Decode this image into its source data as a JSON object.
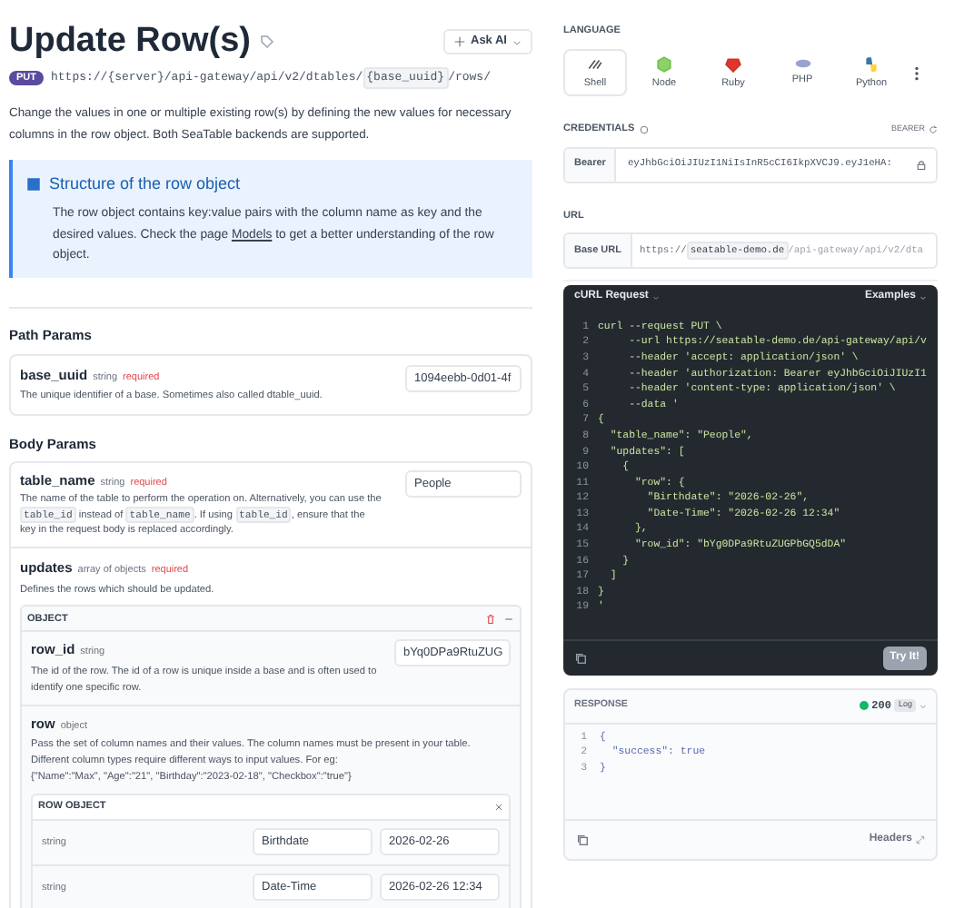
{
  "title": "Update Row(s)",
  "ask_ai": "Ask AI",
  "method": "PUT",
  "endpoint": {
    "prefix": "https://{server}/api-gateway/api/v2/dtables/",
    "param": "{base_uuid}",
    "suffix": "/rows/"
  },
  "description": "Change the values in one or multiple existing row(s) by defining the new values for necessary columns in the row object. Both SeaTable backends are supported.",
  "callout": {
    "title": "Structure of the row object",
    "text_before": "The row object contains key:value pairs with the column name as key and the desired values. Check the page ",
    "link": "Models",
    "text_after": " to get a better understanding of the row object."
  },
  "path_params": {
    "heading": "Path Params",
    "params": [
      {
        "name": "base_uuid",
        "type": "string",
        "required": "required",
        "description": "The unique identifier of a base. Sometimes also called dtable_uuid.",
        "value": "1094eebb-0d01-4f"
      }
    ]
  },
  "body_params": {
    "heading": "Body Params",
    "table_name": {
      "name": "table_name",
      "type": "string",
      "required": "required",
      "description": [
        {
          "kind": "text",
          "text": "The name of the table to perform the operation on. Alternatively, you can use the "
        },
        {
          "kind": "code",
          "text": "table_id"
        },
        {
          "kind": "text",
          "text": " instead of "
        },
        {
          "kind": "code",
          "text": "table_name"
        },
        {
          "kind": "text",
          "text": ". If using "
        },
        {
          "kind": "code",
          "text": "table_id"
        },
        {
          "kind": "text",
          "text": ", ensure that the key in the request body is replaced accordingly."
        }
      ],
      "value": "People"
    },
    "updates": {
      "name": "updates",
      "type": "array of objects",
      "required": "required",
      "description": "Defines the rows which should be updated.",
      "object": {
        "label": "OBJECT",
        "row_id": {
          "name": "row_id",
          "type": "string",
          "description": "The id of the row. The id of a row is unique inside a base and is often used to identify one specific row.",
          "value": "bYq0DPa9RtuZUG"
        },
        "row": {
          "name": "row",
          "type": "object",
          "description": "Pass the set of column names and their values. The column names must be present in your table. Different column types require different ways to input values. For eg:",
          "example": "{\"Name\":\"Max\", \"Age\":\"21\", \"Birthday\":\"2023-02-18\", \"Checkbox\":\"true\"}",
          "row_object": {
            "label": "ROW OBJECT",
            "entries": [
              {
                "type": "string",
                "key": "Birthdate",
                "value": "2026-02-26"
              },
              {
                "type": "string",
                "key": "Date-Time",
                "value": "2026-02-26 12:34"
              }
            ]
          }
        }
      }
    }
  },
  "language": {
    "heading": "LANGUAGE",
    "options": [
      {
        "label": "Shell",
        "kind": "shell",
        "selected": true
      },
      {
        "label": "Node",
        "kind": "node",
        "selected": false
      },
      {
        "label": "Ruby",
        "kind": "ruby",
        "selected": false
      },
      {
        "label": "PHP",
        "kind": "php",
        "selected": false
      },
      {
        "label": "Python",
        "kind": "python",
        "selected": false
      }
    ]
  },
  "credentials": {
    "heading": "CREDENTIALS",
    "auth_type": "BEARER",
    "label": "Bearer",
    "token": "eyJhbGciOiJIUzI1NiIsInR5cCI6IkpXVCJ9.eyJ1eHA:"
  },
  "url": {
    "heading": "URL",
    "label": "Base URL",
    "scheme": "https://",
    "host": "seatable-demo.de",
    "path": "/api-gateway/api/v2/dta"
  },
  "request": {
    "title": "cURL Request",
    "examples": "Examples",
    "try": "Try It!",
    "lines": [
      {
        "n": "1",
        "text": "curl --request PUT \\"
      },
      {
        "n": "2",
        "text": "     --url https://seatable-demo.de/api-gateway/api/v"
      },
      {
        "n": "3",
        "text": "     --header 'accept: application/json' \\"
      },
      {
        "n": "4",
        "text": "     --header 'authorization: Bearer eyJhbGciOiJIUzI1"
      },
      {
        "n": "5",
        "text": "     --header 'content-type: application/json' \\"
      },
      {
        "n": "6",
        "text": "     --data '"
      },
      {
        "n": "7",
        "text": "{"
      },
      {
        "n": "8",
        "text": "  \"table_name\": \"People\","
      },
      {
        "n": "9",
        "text": "  \"updates\": ["
      },
      {
        "n": "10",
        "text": "    {"
      },
      {
        "n": "11",
        "text": "      \"row\": {"
      },
      {
        "n": "12",
        "text": "        \"Birthdate\": \"2026-02-26\","
      },
      {
        "n": "13",
        "text": "        \"Date-Time\": \"2026-02-26 12:34\""
      },
      {
        "n": "14",
        "text": "      },"
      },
      {
        "n": "15",
        "text": "      \"row_id\": \"bYg0DPa9RtuZUGPbGQ5dDA\""
      },
      {
        "n": "16",
        "text": "    }"
      },
      {
        "n": "17",
        "text": "  ]"
      },
      {
        "n": "18",
        "text": "}"
      },
      {
        "n": "19",
        "text": "'"
      }
    ]
  },
  "response": {
    "heading": "RESPONSE",
    "status": "200",
    "log": "Log",
    "headers": "Headers",
    "lines": [
      {
        "n": "1",
        "text": "{"
      },
      {
        "n": "2",
        "text": "  \"success\": true"
      },
      {
        "n": "3",
        "text": "}"
      }
    ]
  }
}
